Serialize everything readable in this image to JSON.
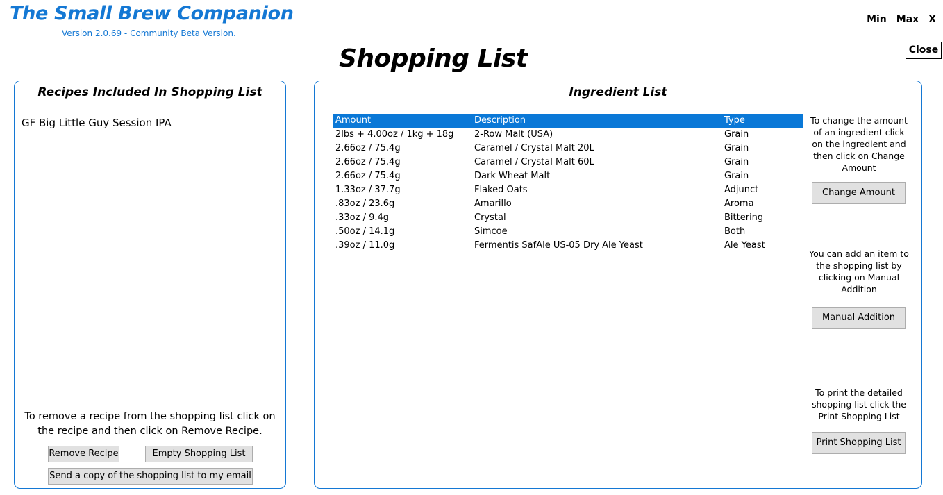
{
  "app": {
    "title": "The Small Brew Companion",
    "version": "Version 2.0.69 - Community Beta Version.",
    "accent_color": "#1478d4"
  },
  "window_controls": {
    "min": "Min",
    "max": "Max",
    "close_x": "X",
    "close_button": "Close"
  },
  "page": {
    "title": "Shopping List"
  },
  "recipes_panel": {
    "heading": "Recipes Included In Shopping List",
    "recipes": [
      "GF Big Little Guy Session IPA"
    ],
    "help_text": "To remove a recipe from the shopping list click on the recipe and then click on Remove Recipe.",
    "remove_button": "Remove Recipe",
    "empty_button": "Empty Shopping List",
    "email_button": "Send a copy of the shopping list to my email"
  },
  "ingredient_panel": {
    "heading": "Ingredient List",
    "columns": {
      "amount": "Amount",
      "description": "Description",
      "type": "Type"
    },
    "header_color": "#0a78d7",
    "rows": [
      {
        "amount": "2lbs + 4.00oz / 1kg + 18g",
        "description": "2-Row Malt (USA)",
        "type": "Grain"
      },
      {
        "amount": "2.66oz / 75.4g",
        "description": "Caramel / Crystal Malt 20L",
        "type": "Grain"
      },
      {
        "amount": "2.66oz / 75.4g",
        "description": "Caramel / Crystal Malt 60L",
        "type": "Grain"
      },
      {
        "amount": "2.66oz / 75.4g",
        "description": "Dark Wheat Malt",
        "type": "Grain"
      },
      {
        "amount": "1.33oz / 37.7g",
        "description": "Flaked Oats",
        "type": "Adjunct"
      },
      {
        "amount": ".83oz / 23.6g",
        "description": "Amarillo",
        "type": "Aroma"
      },
      {
        "amount": ".33oz / 9.4g",
        "description": "Crystal",
        "type": "Bittering"
      },
      {
        "amount": ".50oz / 14.1g",
        "description": "Simcoe",
        "type": "Both"
      },
      {
        "amount": ".39oz / 11.0g",
        "description": "Fermentis SafAle US-05 Dry Ale Yeast",
        "type": "Ale Yeast"
      }
    ],
    "change_help": "To change the amount of an ingredient click on the ingredient and then click on Change Amount",
    "change_button": "Change Amount",
    "manual_help": "You can add an item to the shopping list by clicking on Manual Addition",
    "manual_button": "Manual Addition",
    "print_help": "To print the detailed shopping list click the Print Shopping List",
    "print_button": "Print Shopping List"
  }
}
